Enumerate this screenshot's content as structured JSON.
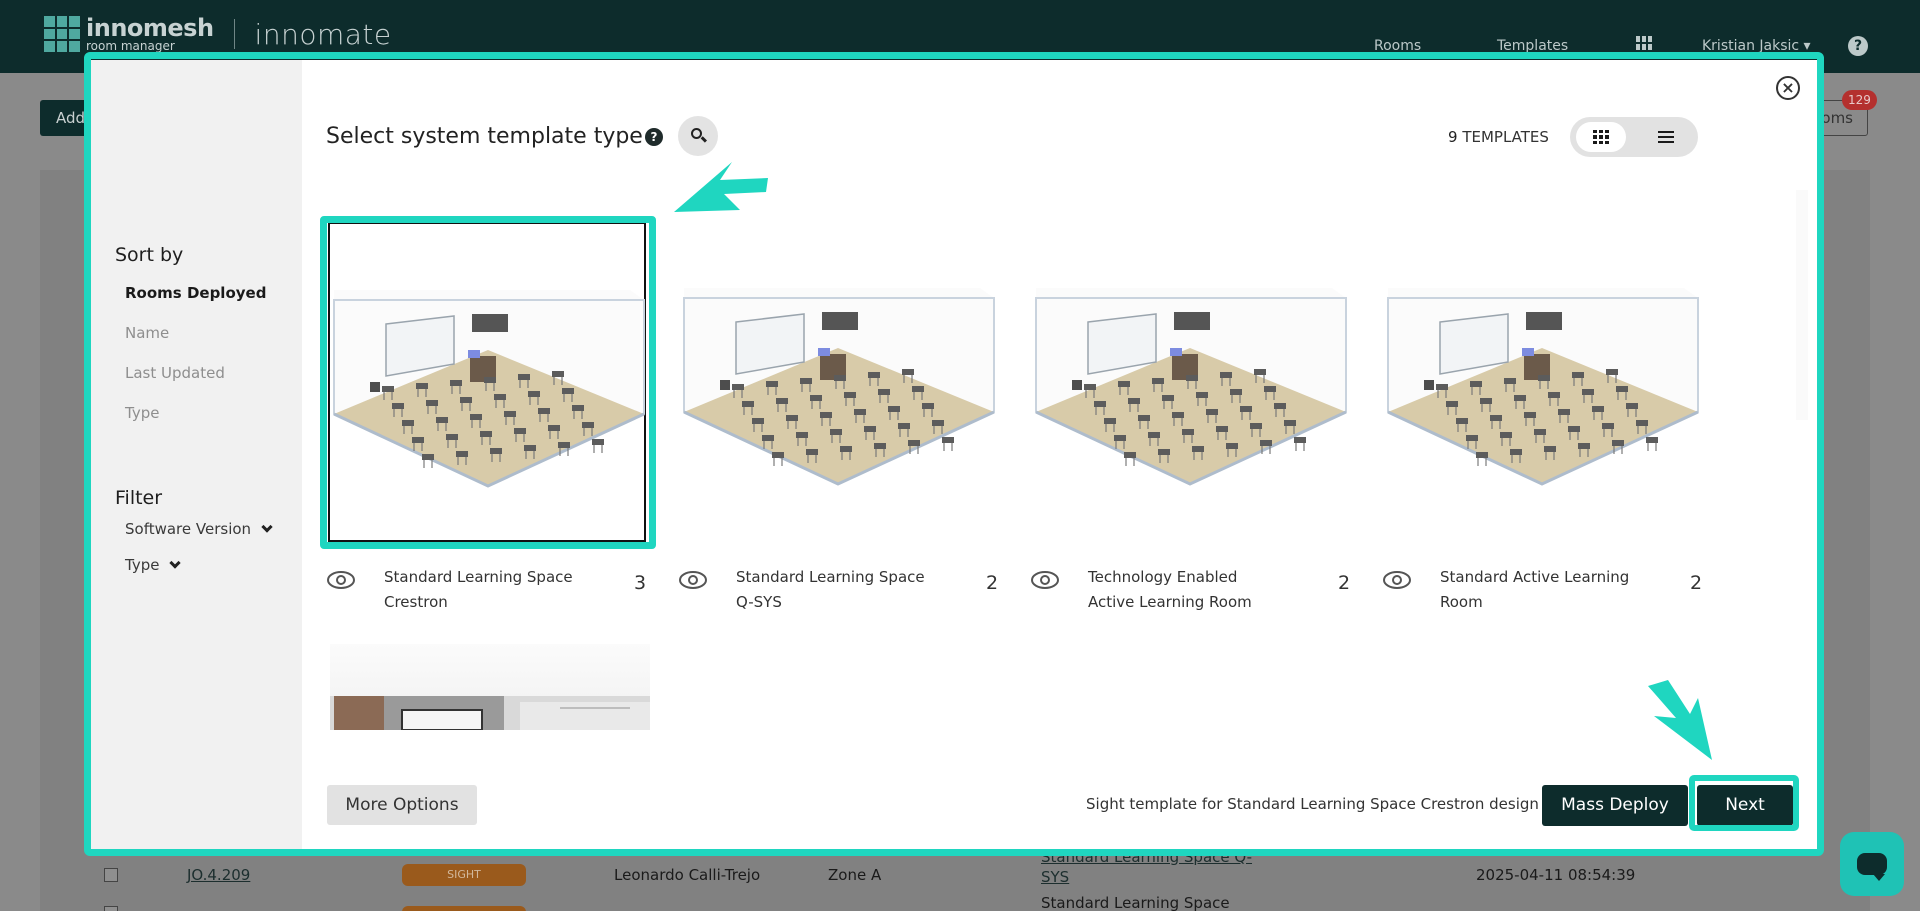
{
  "header": {
    "logo_brand": "innomesh",
    "logo_sub": "room manager",
    "app_name": "innomate",
    "nav": [
      "Rooms",
      "Templates"
    ],
    "user": "Kristian Jaksic ▾",
    "help": "?"
  },
  "toolbar": {
    "add_label": "Add",
    "rooms_label": "Rooms",
    "rooms_badge": "129"
  },
  "table_rows": [
    {
      "room": "JO.4.209",
      "type": "SIGHT",
      "owner": "Leonardo Calli-Trejo",
      "zone": "Zone A",
      "template": "Standard Learning Space Q-",
      "template2": "SYS",
      "date": "2025-04-11 08:54:39"
    },
    {
      "template": "Standard Learning Space"
    }
  ],
  "modal": {
    "title": "Select system template type",
    "help_icon": "?",
    "template_count_num": "9",
    "template_count_label": "TEMPLATES",
    "close_icon": "×",
    "sidebar": {
      "sort_title": "Sort by",
      "sort_items": [
        "Rooms Deployed",
        "Name",
        "Last Updated",
        "Type"
      ],
      "filter_title": "Filter",
      "filter_items": [
        "Software Version",
        "Type"
      ]
    },
    "templates": [
      {
        "name": "Standard Learning Space Crestron",
        "count": "3",
        "selected": true
      },
      {
        "name": "Standard Learning Space Q-SYS",
        "count": "2",
        "selected": false
      },
      {
        "name": "Technology Enabled Active Learning Room",
        "count": "2",
        "selected": false
      },
      {
        "name": "Standard Active Learning Room",
        "count": "2",
        "selected": false
      }
    ],
    "more_options": "More Options",
    "description": "Sight template for Standard Learning Space Crestron design",
    "mass_deploy": "Mass Deploy",
    "next": "Next"
  },
  "colors": {
    "brand_dark": "#0d2c2c",
    "highlight": "#1fd6c0",
    "chat": "#1fc2b5",
    "badge": "#b4302e"
  }
}
